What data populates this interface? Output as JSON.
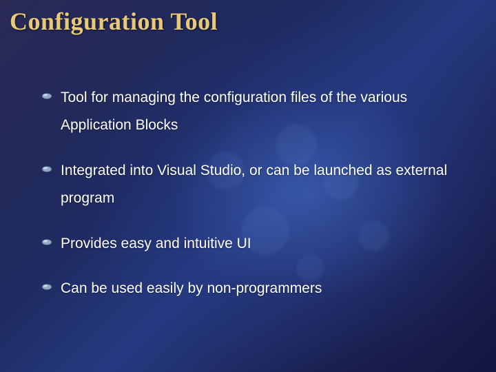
{
  "title": "Configuration Tool",
  "bullets": [
    "Tool for managing the configuration files of the various Application Blocks",
    "Integrated into Visual Studio, or can be launched as external program",
    "Provides easy and intuitive UI",
    "Can be used easily by non-programmers"
  ],
  "colors": {
    "title": "#e8c978",
    "text": "#ffffff",
    "bullet_fill": "#8fa8c8",
    "bullet_stroke": "#3a4a66"
  }
}
